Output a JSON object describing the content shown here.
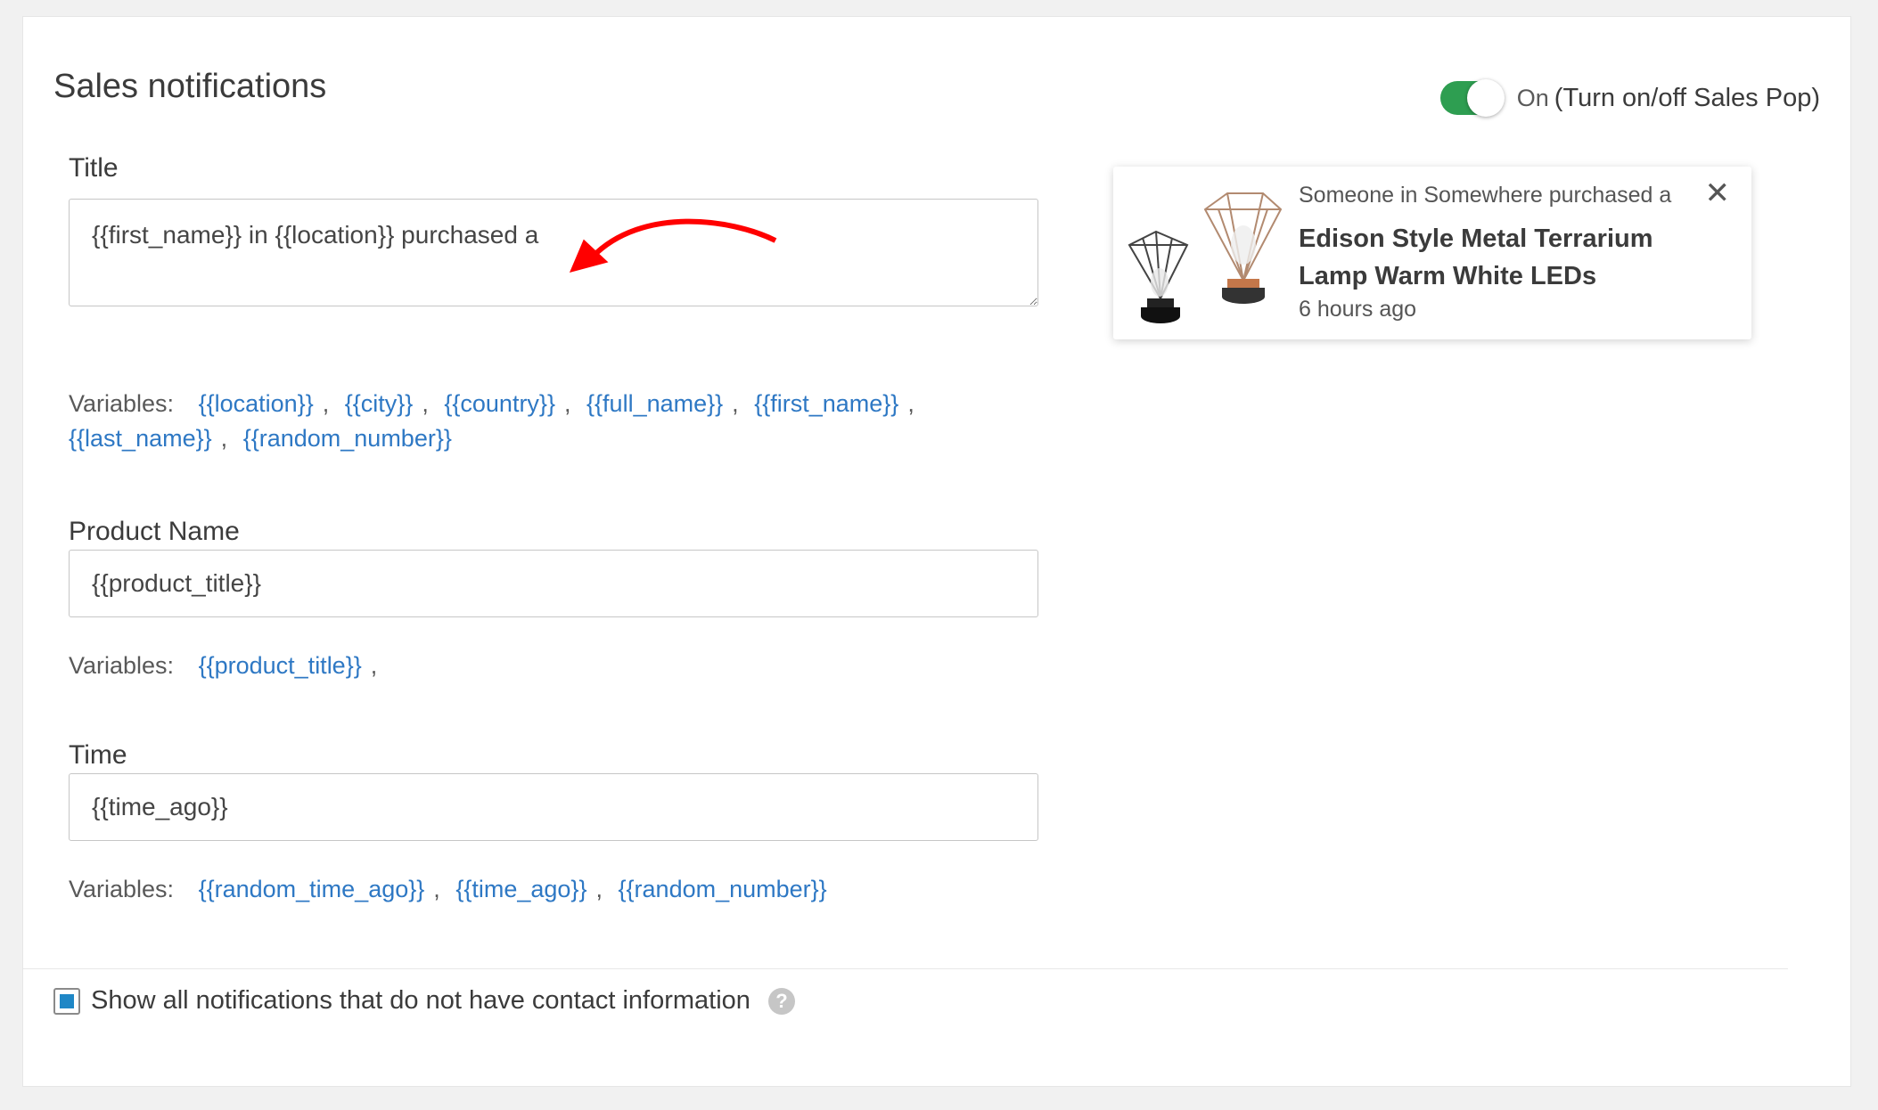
{
  "header": {
    "title": "Sales notifications",
    "toggle_state": "On",
    "toggle_description": "(Turn on/off Sales Pop)",
    "toggle_on": true,
    "toggle_color": "#2e9e51"
  },
  "fields": {
    "title": {
      "label": "Title",
      "value": "{{first_name}} in {{location}} purchased a",
      "variables_label": "Variables:",
      "variables": [
        "{{location}}",
        "{{city}}",
        "{{country}}",
        "{{full_name}}",
        "{{first_name}}",
        "{{last_name}}",
        "{{random_number}}"
      ]
    },
    "product_name": {
      "label": "Product Name",
      "value": "{{product_title}}",
      "variables_label": "Variables:",
      "variables": [
        "{{product_title}}"
      ],
      "trailing": ","
    },
    "time": {
      "label": "Time",
      "value": "{{time_ago}}",
      "variables_label": "Variables:",
      "variables": [
        "{{random_time_ago}}",
        "{{time_ago}}",
        "{{random_number}}"
      ]
    }
  },
  "preview": {
    "line1": "Someone in Somewhere purchased a",
    "product": "Edison Style Metal Terrarium Lamp Warm White LEDs",
    "time": "6 hours ago",
    "close_icon": "close-icon"
  },
  "footer": {
    "checkbox_checked": true,
    "checkbox_label": "Show all notifications that do not have contact information",
    "help_icon": "?"
  },
  "colors": {
    "link": "#2e78c4",
    "checkbox_fill": "#1f87c6",
    "annotation_arrow": "#ff0000"
  }
}
